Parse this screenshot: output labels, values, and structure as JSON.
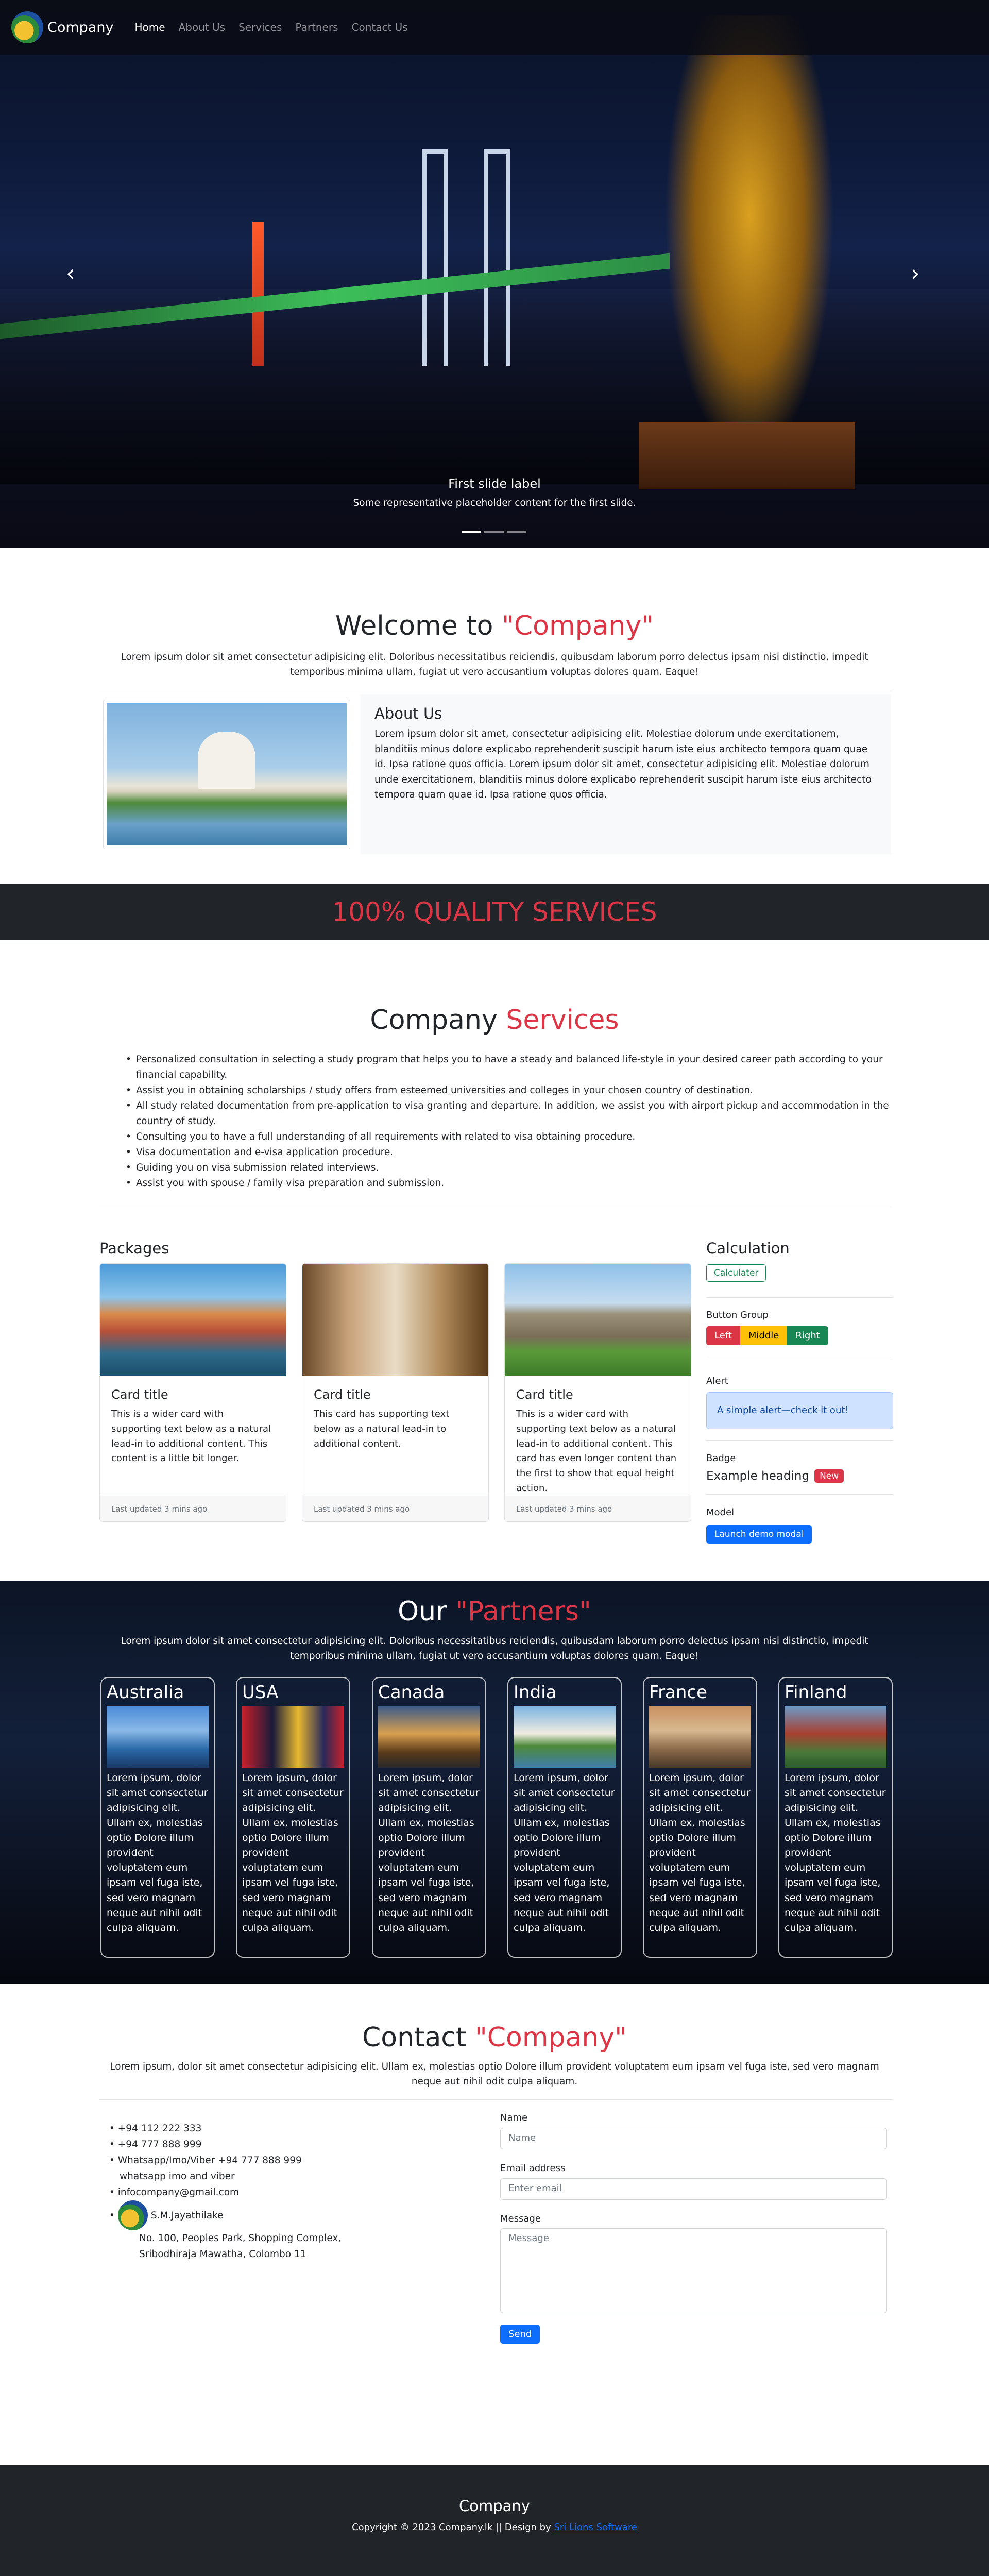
{
  "nav": {
    "brand": "Company",
    "links": [
      "Home",
      "About Us",
      "Services",
      "Partners",
      "Contact Us"
    ]
  },
  "hero": {
    "caption_title": "First slide label",
    "caption_text": "Some representative placeholder content for the first slide.",
    "prev_icon": "chevron-left-icon",
    "next_icon": "chevron-right-icon",
    "slide_count": 3,
    "active_slide": 1
  },
  "welcome": {
    "title_prefix": "Welcome to ",
    "title_highlight": "\"Company\"",
    "lead": "Lorem ipsum dolor sit amet consectetur adipisicing elit. Doloribus necessitatibus reiciendis, quibusdam laborum porro delectus ipsam nisi distinctio, impedit temporibus minima ullam, fugiat ut vero accusantium voluptas dolores quam. Eaque!"
  },
  "about": {
    "title": "About Us",
    "text": "Lorem ipsum dolor sit amet, consectetur adipisicing elit. Molestiae dolorum unde exercitationem, blanditiis minus dolore explicabo reprehenderit suscipit harum iste eius architecto tempora quam quae id. Ipsa ratione quos officia. Lorem ipsum dolor sit amet, consectetur adipisicing elit. Molestiae dolorum unde exercitationem, blanditiis minus dolore explicabo reprehenderit suscipit harum iste eius architecto tempora quam quae id. Ipsa ratione quos officia."
  },
  "quality": "100% QUALITY SERVICES",
  "services": {
    "title_prefix": "Company ",
    "title_highlight": "Services",
    "items": [
      "Personalized consultation in selecting a study program that helps you to have a steady and balanced life-style in your desired career path according to your financial capability.",
      "Assist you in obtaining scholarships / study offers from esteemed universities and colleges in your chosen country of destination.",
      "All study related documentation from pre-application to visa granting and departure. In addition, we assist you with airport pickup and accommodation in the country of study.",
      "Consulting you to have a full understanding of all requirements with related to visa obtaining procedure.",
      "Visa documentation and e-visa application procedure.",
      "Guiding you on visa submission related interviews.",
      "Assist you with spouse / family visa preparation and submission."
    ]
  },
  "packages": {
    "title": "Packages",
    "cards": [
      {
        "title": "Card title",
        "text": "This is a wider card with supporting text below as a natural lead-in to additional content. This content is a little bit longer.",
        "footer": "Last updated 3 mins ago"
      },
      {
        "title": "Card title",
        "text": "This card has supporting text below as a natural lead-in to additional content.",
        "footer": "Last updated 3 mins ago"
      },
      {
        "title": "Card title",
        "text": "This is a wider card with supporting text below as a natural lead-in to additional content. This card has even longer content than the first to show that equal height action.",
        "footer": "Last updated 3 mins ago"
      }
    ]
  },
  "calc": {
    "title": "Calculation",
    "calc_button": "Calculater",
    "group_label": "Button Group",
    "group_buttons": [
      "Left",
      "Middle",
      "Right"
    ],
    "alert_label": "Alert",
    "alert_text": "A simple alert—check it out!",
    "badge_label": "Badge",
    "badge_heading": "Example heading",
    "badge_text": "New",
    "model_label": "Model",
    "modal_button": "Launch demo modal"
  },
  "partners": {
    "title_prefix": "Our ",
    "title_highlight": "\"Partners\"",
    "lead": "Lorem ipsum dolor sit amet consectetur adipisicing elit. Doloribus necessitatibus reiciendis, quibusdam laborum porro delectus ipsam nisi distinctio, impedit temporibus minima ullam, fugiat ut vero accusantium voluptas dolores quam. Eaque!",
    "text": "Lorem ipsum, dolor sit amet consectetur adipisicing elit. Ullam ex, molestias optio Dolore illum provident voluptatem eum ipsam vel fuga iste, sed vero magnam neque aut nihil odit culpa aliquam.",
    "countries": [
      "Australia",
      "USA",
      "Canada",
      "India",
      "France",
      "Finland"
    ]
  },
  "contact": {
    "title_prefix": "Contact ",
    "title_highlight": "\"Company\"",
    "lead": "Lorem ipsum, dolor sit amet consectetur adipisicing elit. Ullam ex, molestias optio Dolore illum provident voluptatem eum ipsam vel fuga iste, sed vero magnam neque aut nihil odit culpa aliquam.",
    "phone1": "+94 112 222 333",
    "phone2": "+94 777 888 999",
    "whatsapp": "Whatsapp/Imo/Viber +94 777 888 999",
    "whatsapp2": "whatsapp imo and viber",
    "email": "infocompany@gmail.com",
    "person": "S.M.Jayathilake",
    "addr1": "No. 100, Peoples Park, Shopping Complex,",
    "addr2": "Sribodhiraja Mawatha, Colombo 11",
    "name_label": "Name",
    "name_ph": "Name",
    "email_label": "Email address",
    "email_ph": "Enter email",
    "msg_label": "Message",
    "msg_ph": "Message",
    "send": "Send"
  },
  "footer": {
    "brand": "Company",
    "copyright": "Copyright © 2023 Company.lk || Design by ",
    "designer": "Sri Lions Software"
  },
  "colors": {
    "accent": "#dc3545",
    "primary": "#0d6efd",
    "success": "#198754",
    "warning": "#ffc107",
    "dark": "#212529"
  }
}
